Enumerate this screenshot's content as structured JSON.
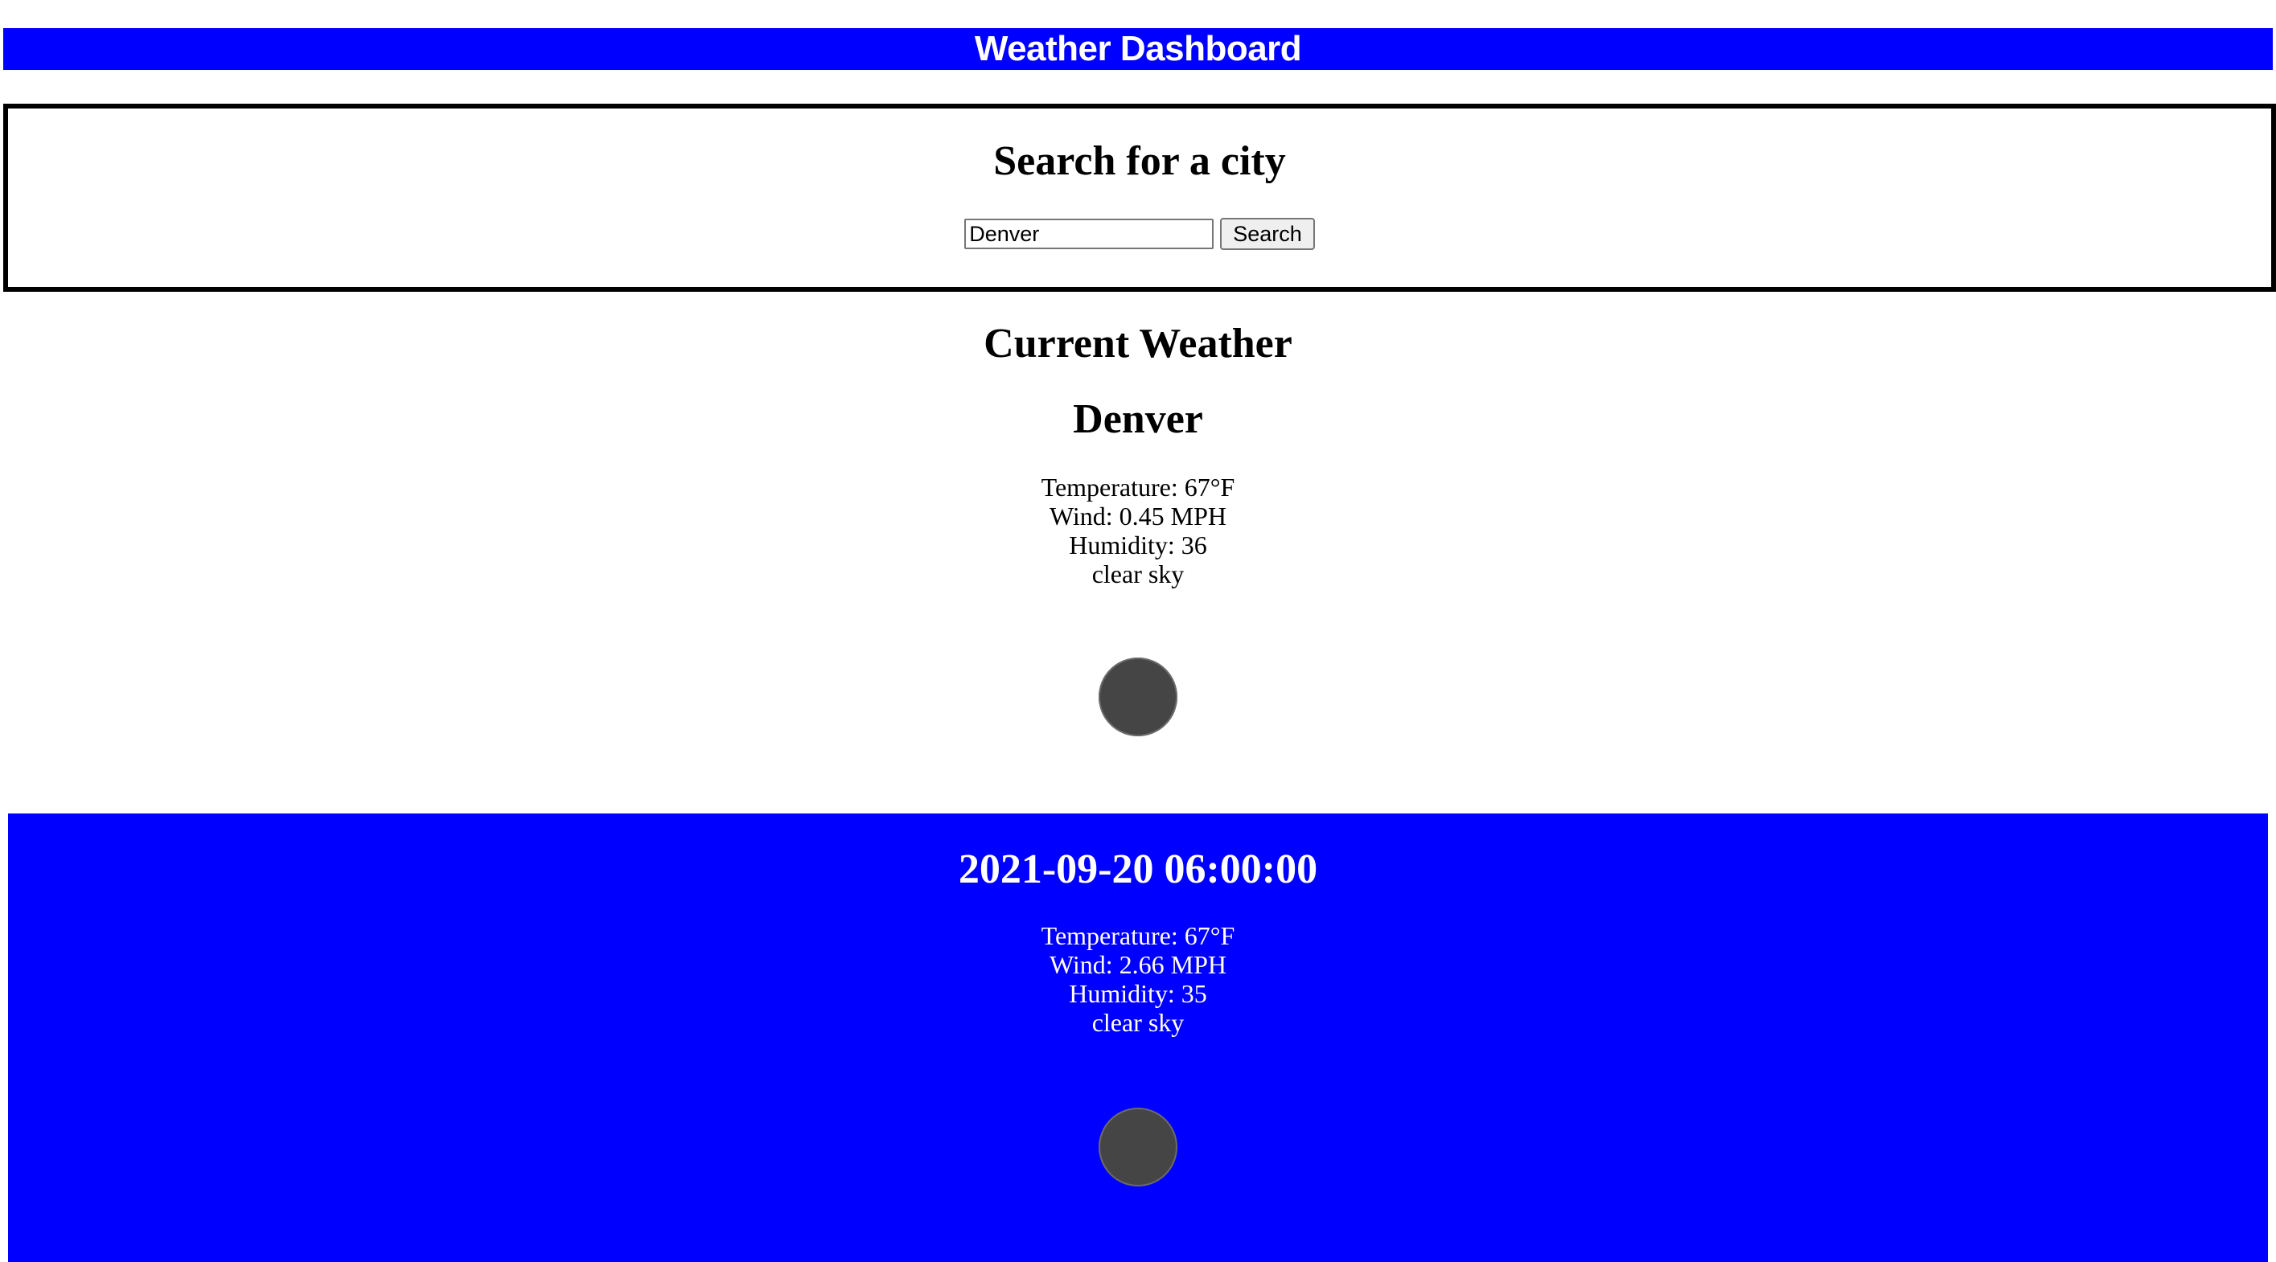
{
  "header": {
    "title": "Weather Dashboard",
    "background": "#0000ff"
  },
  "search": {
    "heading": "Search for a city",
    "input_value": "Denver",
    "button_label": "Search"
  },
  "current": {
    "heading": "Current Weather",
    "city": "Denver",
    "temperature": "Temperature: 67°F",
    "wind": "Wind: 0.45 MPH",
    "humidity": "Humidity: 36",
    "description": "clear sky",
    "icon": "weather-icon"
  },
  "forecast": [
    {
      "datetime": "2021-09-20 06:00:00",
      "temperature": "Temperature: 67°F",
      "wind": "Wind: 2.66 MPH",
      "humidity": "Humidity: 35",
      "description": "clear sky",
      "icon": "weather-icon",
      "background": "#0000ff"
    }
  ]
}
